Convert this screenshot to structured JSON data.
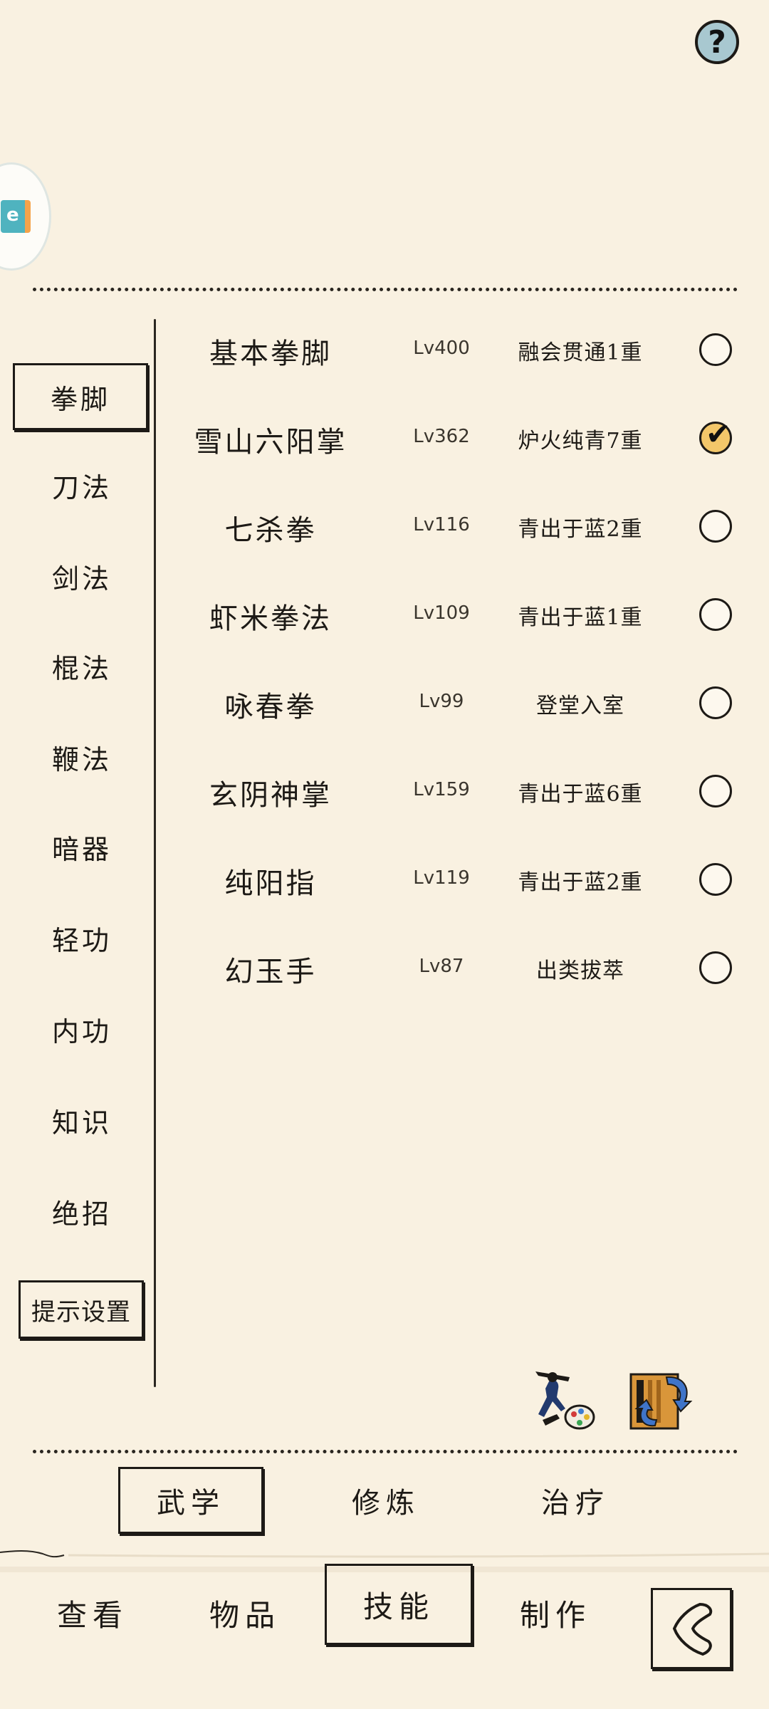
{
  "header": {
    "help_label": "?"
  },
  "floating_widget": {
    "letter": "e"
  },
  "categories": [
    {
      "label": "拳脚",
      "active": true
    },
    {
      "label": "刀法"
    },
    {
      "label": "剑法"
    },
    {
      "label": "棍法"
    },
    {
      "label": "鞭法"
    },
    {
      "label": "暗器"
    },
    {
      "label": "轻功"
    },
    {
      "label": "内功"
    },
    {
      "label": "知识"
    },
    {
      "label": "绝招"
    }
  ],
  "tip_settings_label": "提示设置",
  "skills": [
    {
      "name": "基本拳脚",
      "level": "Lv400",
      "rank": "融会贯通1重",
      "selected": false
    },
    {
      "name": "雪山六阳掌",
      "level": "Lv362",
      "rank": "炉火纯青7重",
      "selected": true
    },
    {
      "name": "七杀拳",
      "level": "Lv116",
      "rank": "青出于蓝2重",
      "selected": false
    },
    {
      "name": "虾米拳法",
      "level": "Lv109",
      "rank": "青出于蓝1重",
      "selected": false
    },
    {
      "name": "咏春拳",
      "level": "Lv99",
      "rank": "登堂入室",
      "selected": false
    },
    {
      "name": "玄阴神掌",
      "level": "Lv159",
      "rank": "青出于蓝6重",
      "selected": false
    },
    {
      "name": "纯阳指",
      "level": "Lv119",
      "rank": "青出于蓝2重",
      "selected": false
    },
    {
      "name": "幻玉手",
      "level": "Lv87",
      "rank": "出类拔萃",
      "selected": false
    }
  ],
  "action_icons": {
    "left": "martial-artist-palette-icon",
    "right": "book-swap-icon"
  },
  "sub_tabs": [
    {
      "label": "武学",
      "active": true
    },
    {
      "label": "修炼"
    },
    {
      "label": "治疗"
    }
  ],
  "bottom_nav": [
    {
      "label": "查看"
    },
    {
      "label": "物品"
    },
    {
      "label": "技能",
      "active": true
    },
    {
      "label": "制作"
    }
  ],
  "colors": {
    "background": "#f9f1e1",
    "ink": "#1d1a16",
    "check_fill": "#f3c76a",
    "help_fill": "#a8c8d0"
  }
}
